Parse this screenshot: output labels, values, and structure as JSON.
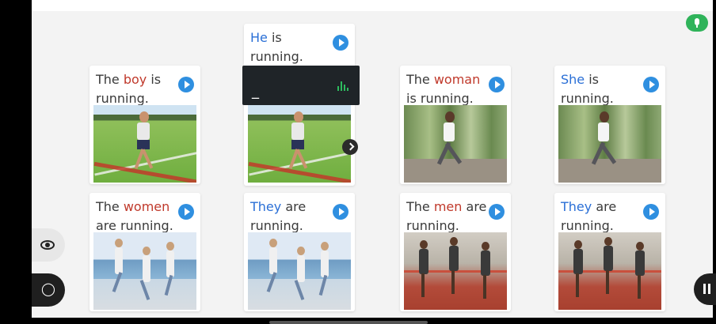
{
  "cards": [
    {
      "id": "c1",
      "parts": [
        {
          "t": "The ",
          "c": "plain"
        },
        {
          "t": "boy",
          "c": "red"
        },
        {
          "t": " is running.",
          "c": "plain"
        }
      ],
      "photo": "boy-running"
    },
    {
      "id": "c2",
      "parts": [
        {
          "t": "He",
          "c": "blue"
        },
        {
          "t": " is running.",
          "c": "plain"
        }
      ],
      "photo": "boy-running"
    },
    {
      "id": "c3",
      "parts": [
        {
          "t": "The ",
          "c": "plain"
        },
        {
          "t": "woman",
          "c": "red"
        },
        {
          "t": " is running.",
          "c": "plain"
        }
      ],
      "photo": "woman-running"
    },
    {
      "id": "c4",
      "parts": [
        {
          "t": "She",
          "c": "blue"
        },
        {
          "t": " is running.",
          "c": "plain"
        }
      ],
      "photo": "woman-running"
    },
    {
      "id": "c5",
      "parts": [
        {
          "t": "The ",
          "c": "plain"
        },
        {
          "t": "women",
          "c": "red"
        },
        {
          "t": " are running.",
          "c": "plain"
        }
      ],
      "photo": "women-running-beach"
    },
    {
      "id": "c6",
      "parts": [
        {
          "t": "They",
          "c": "blue"
        },
        {
          "t": " are running.",
          "c": "plain"
        }
      ],
      "photo": "women-running-beach"
    },
    {
      "id": "c7",
      "parts": [
        {
          "t": "The ",
          "c": "plain"
        },
        {
          "t": "men",
          "c": "red"
        },
        {
          "t": " are running.",
          "c": "plain"
        }
      ],
      "photo": "men-running-track"
    },
    {
      "id": "c8",
      "parts": [
        {
          "t": "They",
          "c": "blue"
        },
        {
          "t": " are running.",
          "c": "plain"
        }
      ],
      "photo": "men-running-track"
    }
  ],
  "popup": {
    "text": "_",
    "icon": "audio-wave-icon"
  },
  "controls": {
    "mic": "microphone-icon",
    "reveal": "eye-icon",
    "hint": "lightbulb-icon",
    "pause": "pause-icon",
    "next": "chevron-right-icon"
  },
  "colors": {
    "pronoun": "#2a6fd6",
    "noun": "#c0392b",
    "play": "#2f8fe0",
    "mic": "#2fb35a",
    "popup_bg": "#1f2428"
  }
}
